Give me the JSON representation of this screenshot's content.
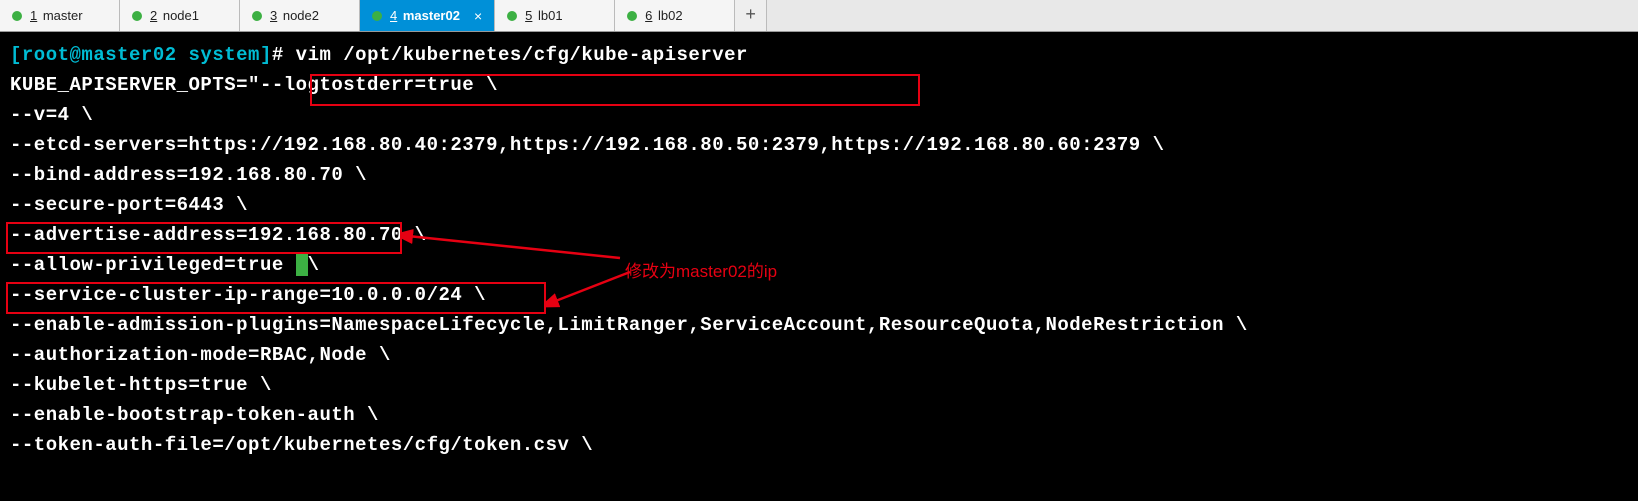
{
  "tabs": [
    {
      "num": "1",
      "label": "master",
      "dot": "green",
      "active": false,
      "close": false
    },
    {
      "num": "2",
      "label": "node1",
      "dot": "green",
      "active": false,
      "close": false
    },
    {
      "num": "3",
      "label": "node2",
      "dot": "green",
      "active": false,
      "close": false
    },
    {
      "num": "4",
      "label": "master02",
      "dot": "green",
      "active": true,
      "close": true
    },
    {
      "num": "5",
      "label": "lb01",
      "dot": "green",
      "active": false,
      "close": false
    },
    {
      "num": "6",
      "label": "lb02",
      "dot": "green",
      "active": false,
      "close": false
    }
  ],
  "add_symbol": "+",
  "close_symbol": "×",
  "prompt": {
    "user": "[root@master02 ",
    "path": "system]",
    "hash": "# ",
    "command": "vim /opt/kubernetes/cfg/kube-apiserver"
  },
  "config_lines": [
    "",
    "KUBE_APISERVER_OPTS=\"--logtostderr=true \\",
    "--v=4 \\",
    "--etcd-servers=https://192.168.80.40:2379,https://192.168.80.50:2379,https://192.168.80.60:2379 \\",
    "--bind-address=192.168.80.70 \\",
    "--secure-port=6443 \\",
    "--advertise-address=192.168.80.70 \\",
    "--allow-privileged=true ",
    "--service-cluster-ip-range=10.0.0.0/24 \\",
    "--enable-admission-plugins=NamespaceLifecycle,LimitRanger,ServiceAccount,ResourceQuota,NodeRestriction \\",
    "--authorization-mode=RBAC,Node \\",
    "--kubelet-https=true \\",
    "--enable-bootstrap-token-auth \\",
    "--token-auth-file=/opt/kubernetes/cfg/token.csv \\"
  ],
  "cursor_line_index": 7,
  "cursor_trail": "\\",
  "annotation_text": "修改为master02的ip",
  "colors": {
    "highlight": "#e60012",
    "prompt": "#00bcd4",
    "tab_active": "#0090d8",
    "dot_green": "#3cb043"
  }
}
